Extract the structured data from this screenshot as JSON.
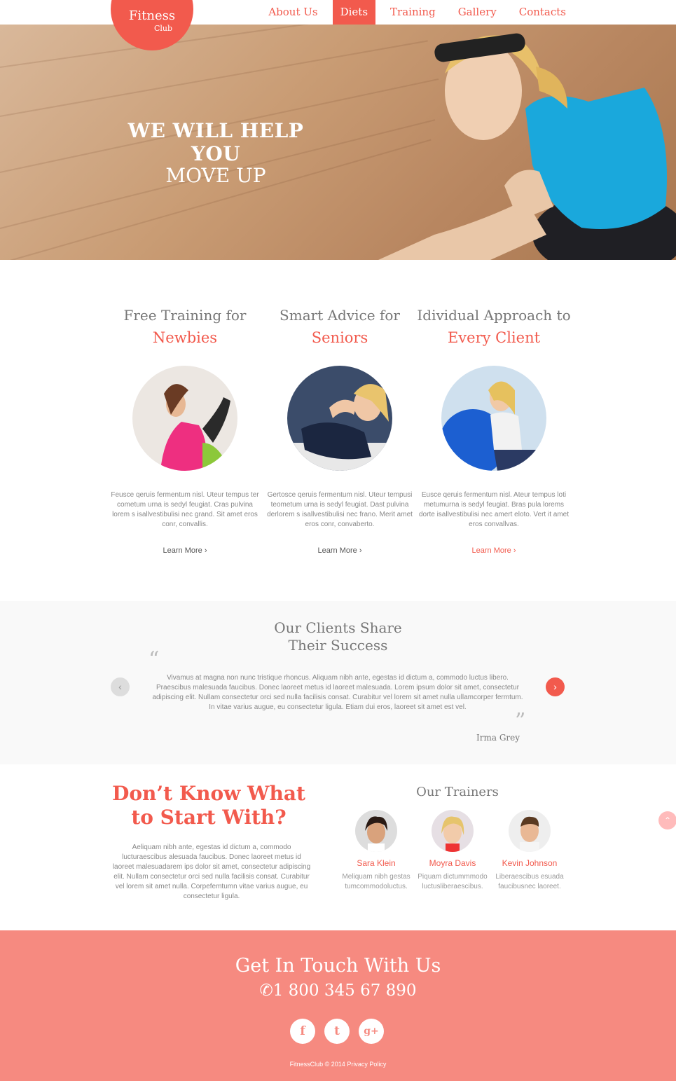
{
  "logo": {
    "line1": "Fitness",
    "line2": "Club"
  },
  "nav": [
    {
      "label": "About Us",
      "active": false
    },
    {
      "label": "Diets",
      "active": true
    },
    {
      "label": "Training",
      "active": false
    },
    {
      "label": "Gallery",
      "active": false
    },
    {
      "label": "Contacts",
      "active": false
    }
  ],
  "hero": {
    "line1": "WE WILL HELP YOU",
    "line2": "MOVE UP"
  },
  "features": [
    {
      "heading": "Free Training for",
      "highlight": "Newbies",
      "text": "Feusce qeruis fermentum nisl. Uteur tempus ter cometum urna is sedyl feugiat. Cras pulvina lorem s isallvestibulisi nec grand. Sit amet eros conr, convallis.",
      "more": "Learn More"
    },
    {
      "heading": "Smart Advice for",
      "highlight": "Seniors",
      "text": "Gertosce qeruis fermentum nisl. Uteur tempusi teometum urna is sedyl feugiat. Dast pulvina derlorem s isallvestibulisi nec frano. Merit amet eros conr, convaberto.",
      "more": "Learn More"
    },
    {
      "heading": "Idividual Approach to",
      "highlight": "Every Client",
      "text": "Eusce qeruis fermentum nisl. Ateur tempus loti metumurna is sedyl feugiat. Bras pula lorems dorte isallvestibulisi nec  amert eloto. Vert it amet eros convallvas.",
      "more": "Learn More"
    }
  ],
  "testimonials": {
    "title_line1": "Our Clients Share",
    "title_line2": "Their Success",
    "text": "Vivamus at magna non nunc tristique rhoncus. Aliquam nibh ante, egestas id dictum a, commodo luctus libero. Praescibus malesuada faucibus. Donec laoreet metus id laoreet malesuada. Lorem ipsum dolor sit amet, consectetur adipiscing elit. Nullam consectetur orci sed nulla facilisis consat. Curabitur vel lorem sit amet nulla ullamcorper fermtum. In vitae varius augue, eu consectetur ligula. Etiam dui eros, laoreet sit amet est vel.",
    "author": "Irma Grey",
    "prev": "‹",
    "next": "›"
  },
  "dont_know": {
    "line1": "Don’t Know What",
    "line2": "to Start With?",
    "text": "Aeliquam nibh ante, egestas id dictum a, commodo lucturaescibus alesuada faucibus. Donec laoreet metus id laoreet malesuadarem ips dolor sit amet, consectetur adipiscing elit. Nullam consectetur orci sed nulla facilisis consat. Curabitur vel lorem sit amet nulla. Corpefemtumn vitae varius augue, eu consectetur ligula."
  },
  "trainers": {
    "title": "Our Trainers",
    "items": [
      {
        "name": "Sara Klein",
        "desc_line1": "Meliquam nibh gestas",
        "desc_line2": "tumcommodoluctus."
      },
      {
        "name": "Moyra Davis",
        "desc_line1": "Piquam dictummmodo",
        "desc_line2": "luctusliberaescibus."
      },
      {
        "name": "Kevin Johnson",
        "desc_line1": "Liberaescibus esuada",
        "desc_line2": "faucibusnec laoreet."
      }
    ]
  },
  "totop": "⌃",
  "footer": {
    "title": "Get In Touch With Us",
    "phone": "1 800 345 67 890",
    "socials": [
      {
        "icon": "facebook-icon",
        "glyph": "f"
      },
      {
        "icon": "twitter-icon",
        "glyph": "t"
      },
      {
        "icon": "google-plus-icon",
        "glyph": "g+"
      }
    ],
    "copyright": "FitnessClub © 2014",
    "privacy": "Privacy Policy"
  },
  "colors": {
    "accent": "#f25a4d",
    "footer_bg": "#f68a80"
  }
}
